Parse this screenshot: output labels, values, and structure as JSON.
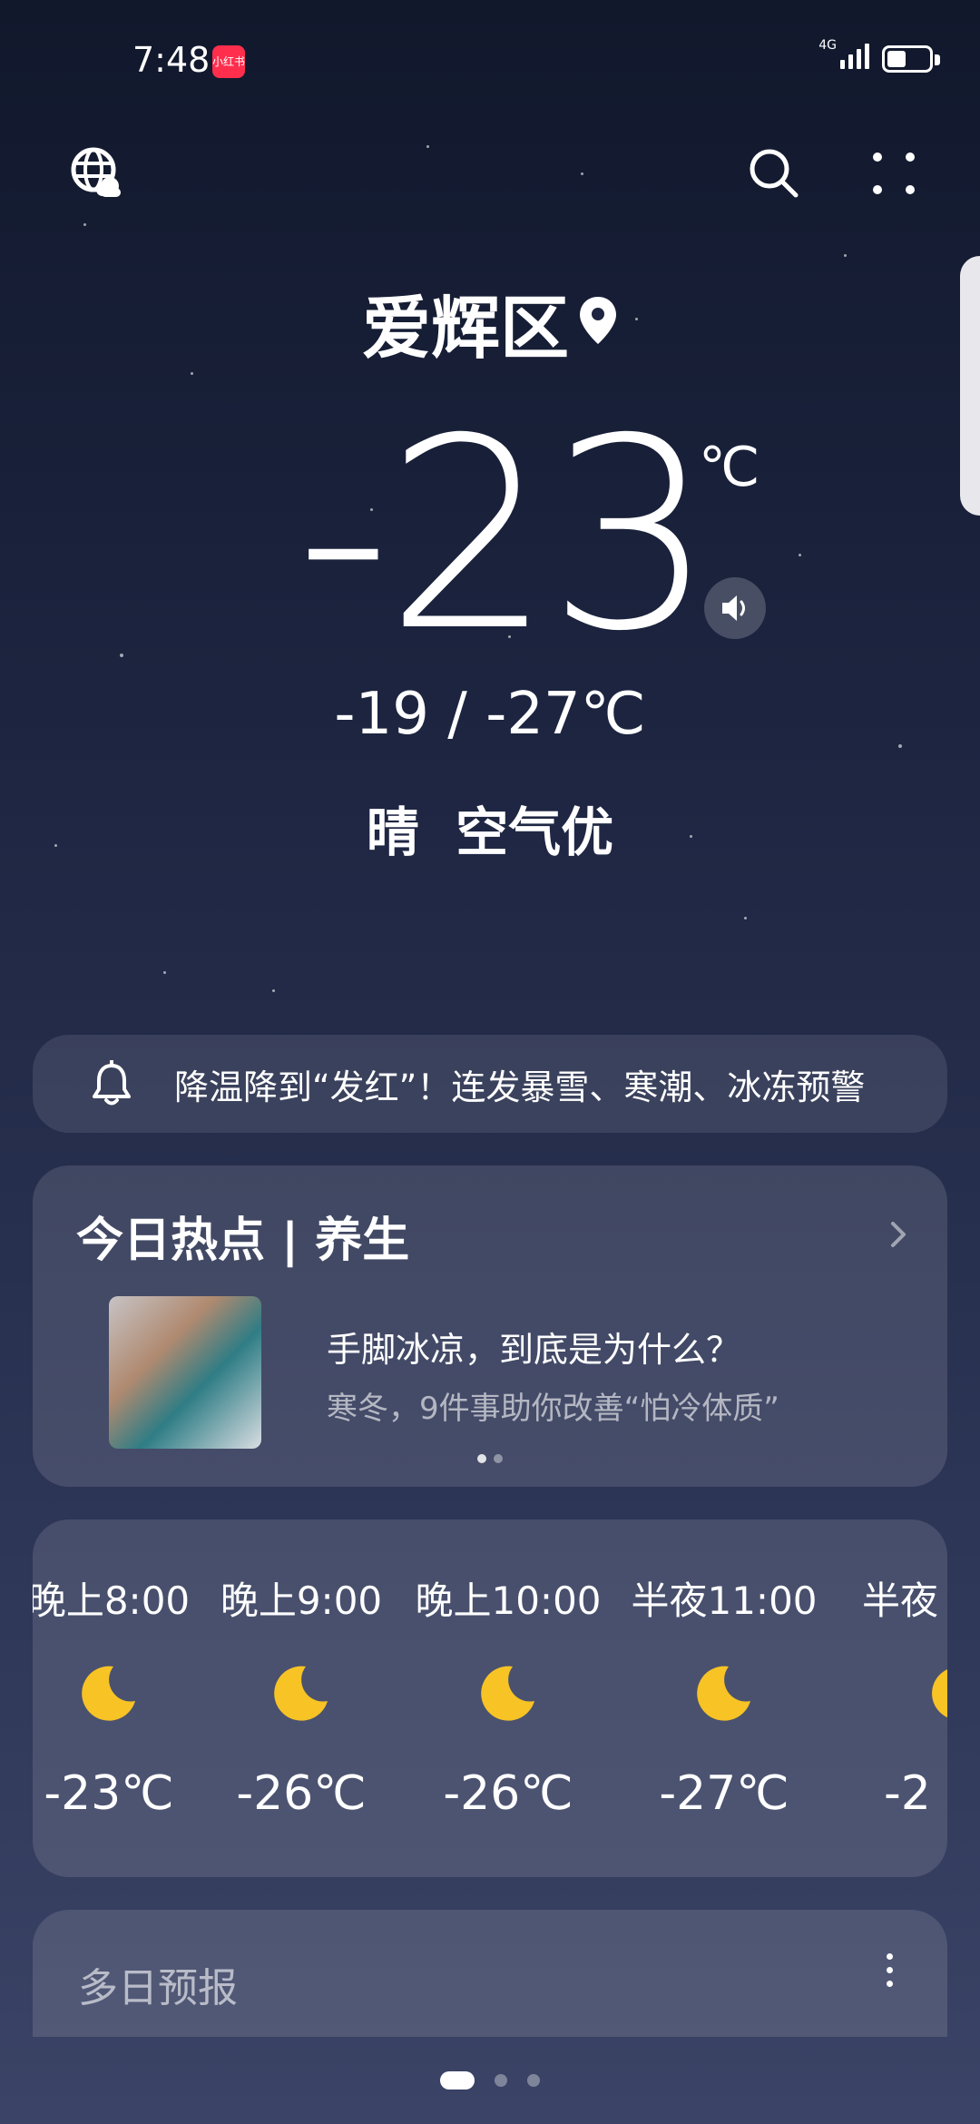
{
  "status_bar": {
    "time": "7:48",
    "app_badge": "小红书",
    "network": "4G",
    "battery_level": 0.45
  },
  "top_bar": {
    "globe_icon": "globe-cloud-icon",
    "search_icon": "search-icon",
    "menu_icon": "grid-dots-icon"
  },
  "location": {
    "name": "爱辉区",
    "icon": "location-pin-icon"
  },
  "current": {
    "temperature": "-23",
    "unit": "℃",
    "range": "-19 / -27℃",
    "condition": "晴",
    "air_quality": "空气优"
  },
  "alert": {
    "icon": "bell-icon",
    "text": "降温降到“发红”！连发暴雪、寒潮、冰冻预警"
  },
  "hotspot": {
    "title": "今日热点 | 养生",
    "headline": "手脚冰凉，到底是为什么？",
    "subtitle": "寒冬，9件事助你改善“怕冷体质”"
  },
  "hourly": [
    {
      "time": "晚上8:00",
      "icon": "moon-icon",
      "temp": "-23℃"
    },
    {
      "time": "晚上9:00",
      "icon": "moon-icon",
      "temp": "-26℃"
    },
    {
      "time": "晚上10:00",
      "icon": "moon-icon",
      "temp": "-26℃"
    },
    {
      "time": "半夜11:00",
      "icon": "moon-icon",
      "temp": "-27℃"
    },
    {
      "time": "半夜",
      "icon": "moon-icon",
      "temp": "-2"
    }
  ],
  "forecast": {
    "title": "多日预报"
  },
  "colors": {
    "moon": "#f7c325",
    "badge": "#ff2e4d"
  }
}
